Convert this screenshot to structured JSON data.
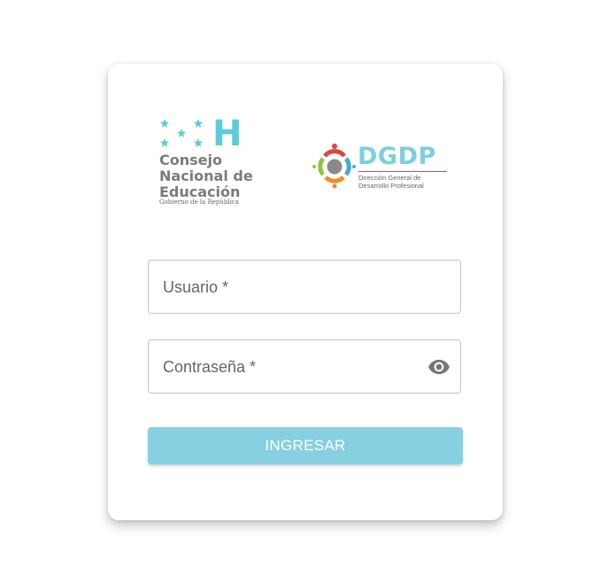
{
  "logos": {
    "cne": {
      "letter": "H",
      "name_lines": [
        "Consejo",
        "Nacional de",
        "Educación"
      ],
      "subtitle": "Gobierno de la República",
      "color_accent": "#5ccbdb",
      "color_text": "#7b7b7b"
    },
    "dgdp": {
      "title": "DGDP",
      "subtitle_lines": [
        "Dirección General de",
        "Desarrollo Profesional"
      ],
      "color_title": "#7ecfdc",
      "color_rule": "#d04a6c"
    }
  },
  "form": {
    "username": {
      "label": "Usuario *",
      "value": ""
    },
    "password": {
      "label": "Contraseña *",
      "value": "",
      "toggle_icon": "eye-icon"
    },
    "submit_label": "INGRESAR",
    "submit_color": "#87d0e1"
  }
}
